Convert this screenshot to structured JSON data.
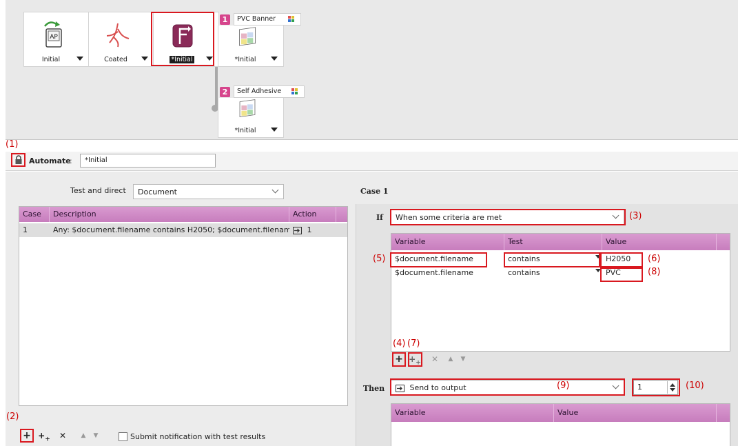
{
  "workflow": {
    "nodes": [
      {
        "caption": "Initial",
        "icon": "ap-apogee-icon"
      },
      {
        "caption": "Coated",
        "icon": "pdf-coated-icon"
      },
      {
        "caption": "*Initial",
        "icon": "route-signpost-icon"
      },
      {
        "caption": "*Initial",
        "icon": "color-swatch-icon"
      },
      {
        "caption": "*Initial",
        "icon": "color-swatch-icon"
      }
    ],
    "branches": [
      {
        "number": "1",
        "name": "PVC Banner"
      },
      {
        "number": "2",
        "name": "Self Adhesive"
      }
    ]
  },
  "annotations": {
    "a1": "(1)",
    "a2": "(2)",
    "a3": "(3)",
    "a4": "(4)",
    "a5": "(5)",
    "a6": "(6)",
    "a7": "(7)",
    "a8": "(8)",
    "a9": "(9)",
    "a10": "(10)"
  },
  "automate": {
    "label": "Automate",
    "colon": ":",
    "value": "*Initial"
  },
  "left": {
    "test_label": "Test and direct",
    "test_value": "Document",
    "headers": {
      "case": "Case",
      "description": "Description",
      "action": "Action"
    },
    "rows": [
      {
        "case": "1",
        "description": "Any: $document.filename contains H2050; $document.filenam...",
        "action": "1"
      }
    ],
    "notify_label": "Submit notification with test results"
  },
  "right": {
    "case_title": "Case 1",
    "if_label": "If",
    "if_value": "When some criteria are met",
    "headers": {
      "variable": "Variable",
      "test": "Test",
      "value": "Value"
    },
    "rows": [
      {
        "variable": "$document.filename",
        "test": "contains",
        "value": "H2050"
      },
      {
        "variable": "$document.filename",
        "test": "contains",
        "value": "PVC"
      }
    ],
    "then_label": "Then",
    "then_value": "Send to output",
    "output_number": "1",
    "out_headers": {
      "variable": "Variable",
      "value": "Value"
    }
  },
  "colors": {
    "accent_header": "#c77dbd",
    "annotation_red": "#d9181f",
    "badge_pink": "#d6458c"
  }
}
